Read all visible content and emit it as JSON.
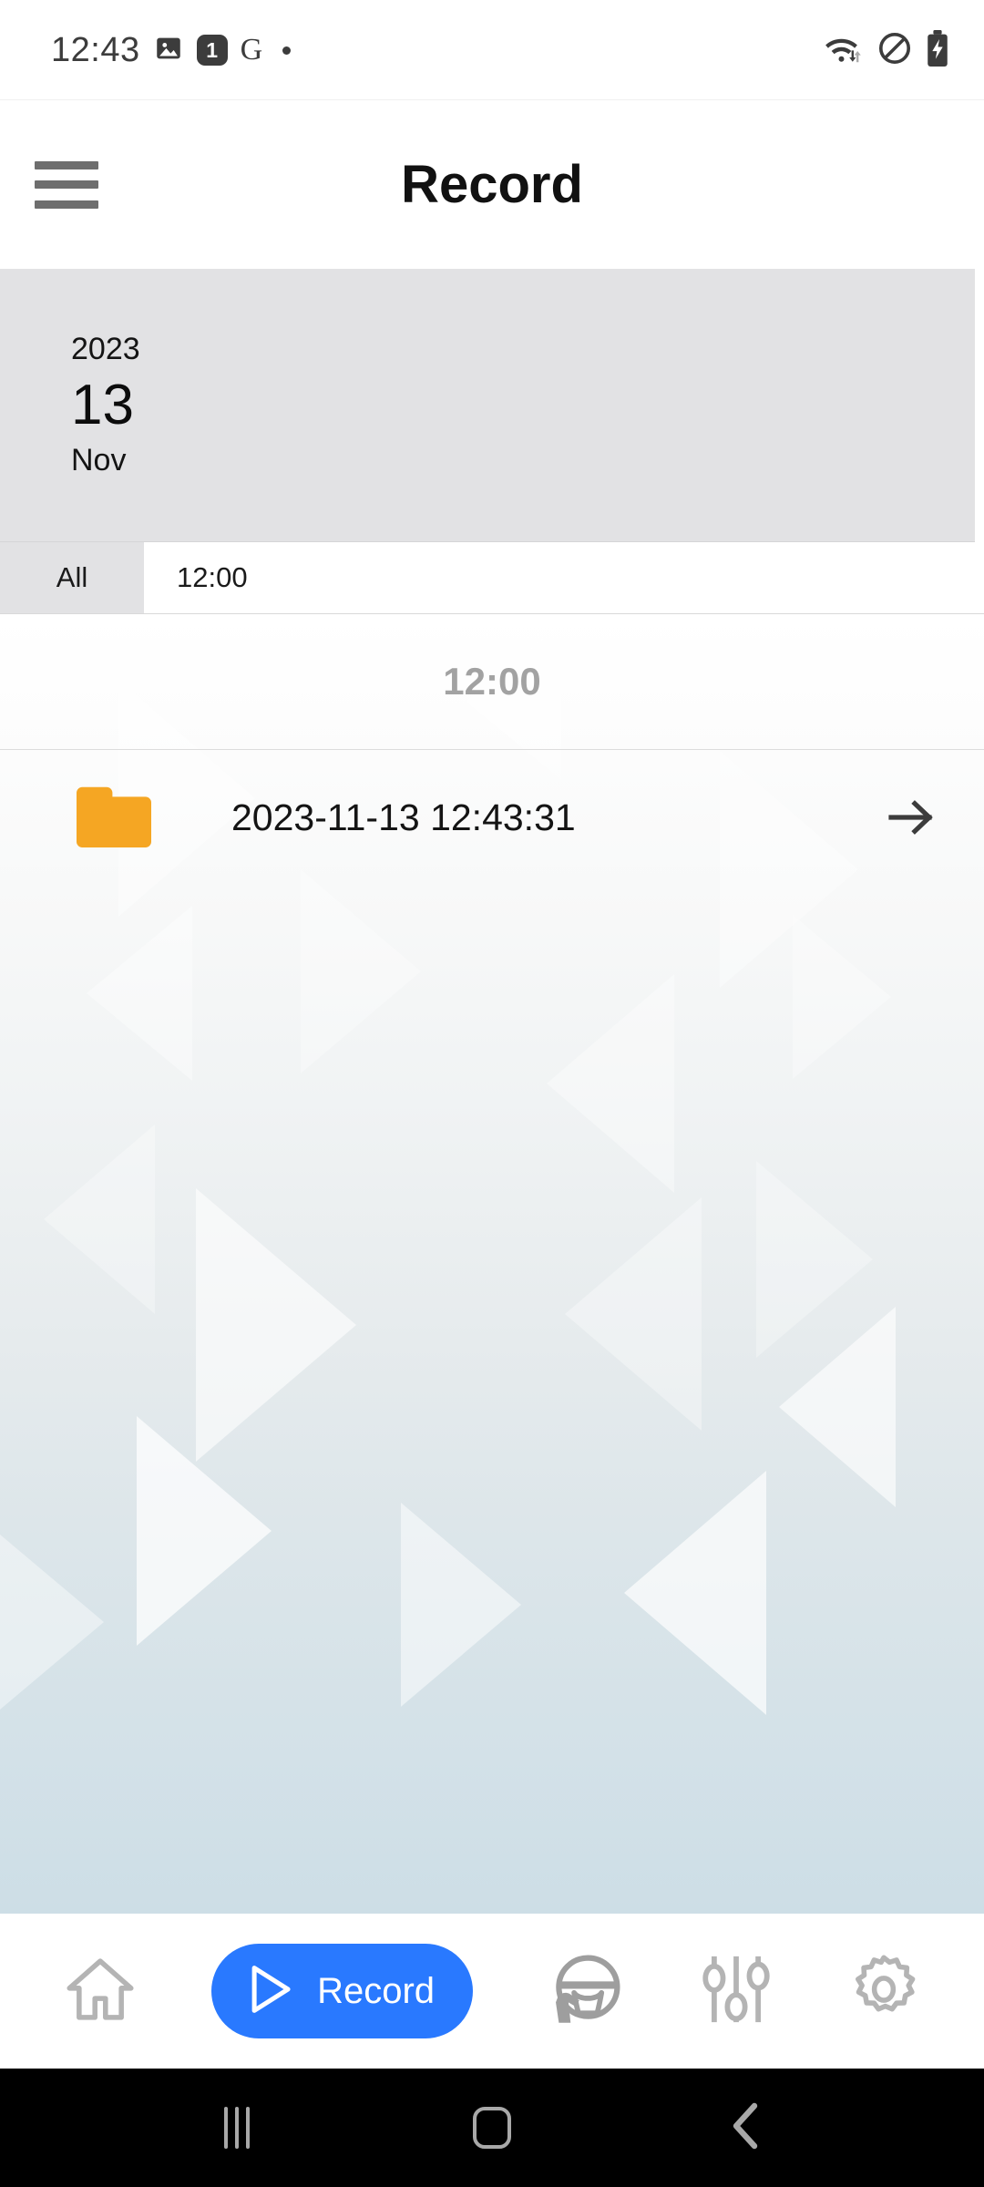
{
  "status_bar": {
    "clock": "12:43",
    "left_icons": [
      {
        "name": "photo-icon",
        "label": "image"
      },
      {
        "name": "notification-count-badge",
        "label": "1"
      },
      {
        "name": "google-icon",
        "label": "G"
      },
      {
        "name": "more-notifications-dot",
        "label": "•"
      }
    ],
    "right_icons": [
      {
        "name": "wifi-icon",
        "label": "wifi"
      },
      {
        "name": "do-not-disturb-icon",
        "label": "dnd"
      },
      {
        "name": "battery-charging-icon",
        "label": "battery"
      }
    ]
  },
  "header": {
    "title": "Record",
    "menu_icon": "hamburger-menu-icon"
  },
  "date_card": {
    "year": "2023",
    "day": "13",
    "month": "Nov",
    "background_color": "#e2e2e4"
  },
  "tabs": [
    {
      "label": "All",
      "selected": false
    },
    {
      "label": "12:00",
      "selected": true
    }
  ],
  "section": {
    "header": "12:00"
  },
  "records": [
    {
      "icon": "folder-icon",
      "icon_color": "#F5A623",
      "label": "2023-11-13 12:43:31",
      "arrow": "arrow-right-icon"
    }
  ],
  "bottom_nav": [
    {
      "name": "home",
      "label": "",
      "icon": "home-icon",
      "active": false
    },
    {
      "name": "record",
      "label": "Record",
      "icon": "play-triangle-icon",
      "active": true
    },
    {
      "name": "driving",
      "label": "",
      "icon": "steering-wheel-icon",
      "active": false
    },
    {
      "name": "tuning",
      "label": "",
      "icon": "sliders-icon",
      "active": false
    },
    {
      "name": "settings",
      "label": "",
      "icon": "gear-icon",
      "active": false
    }
  ],
  "system_nav": [
    {
      "name": "recents",
      "icon": "recents-icon"
    },
    {
      "name": "home",
      "icon": "home-square-icon"
    },
    {
      "name": "back",
      "icon": "back-chevron-icon"
    }
  ],
  "colors": {
    "accent": "#2979FF",
    "folder": "#F5A623",
    "card_gray": "#e2e2e4",
    "section_text": "#a2a2a2"
  }
}
